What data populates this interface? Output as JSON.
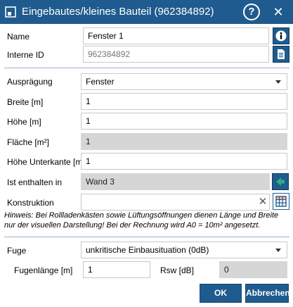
{
  "window": {
    "title": "Eingebautes/kleines Bauteil (962384892)",
    "help_icon": "question-icon",
    "close_icon": "close-icon"
  },
  "general": {
    "name_label": "Name",
    "name_value": "Fenster 1",
    "id_label": "Interne ID",
    "id_value": "962384892"
  },
  "props": {
    "auspraegung_label": "Ausprägung",
    "auspraegung_value": "Fenster",
    "breite_label": "Breite [m]",
    "breite_value": "1",
    "hoehe_label": "Höhe [m]",
    "hoehe_value": "1",
    "flaeche_label": "Fläche [m²]",
    "flaeche_value": "1",
    "unterkante_label": "Höhe Unterkante [m]",
    "unterkante_value": "1",
    "enthalten_label": "Ist enthalten in",
    "enthalten_value": "Wand 3",
    "konstruktion_label": "Konstruktion",
    "konstruktion_value": ""
  },
  "hint": "Hinweis: Bei Rollladenkästen sowie Lüftungsöffnungen dienen Länge und Breite nur der visuellen Darstellung! Bei der Rechnung wird A0 = 10m² angesetzt.",
  "fuge": {
    "fuge_label": "Fuge",
    "fuge_value": "unkritische Einbausituation (0dB)",
    "laenge_label": "Fugenlänge [m]",
    "laenge_value": "1",
    "rsw_label": "Rsw [dB]",
    "rsw_value": "0"
  },
  "buttons": {
    "ok": "OK",
    "cancel": "Abbrechen"
  },
  "colors": {
    "accent": "#1f5b8e",
    "nav_arrow": "#2fb07a"
  }
}
